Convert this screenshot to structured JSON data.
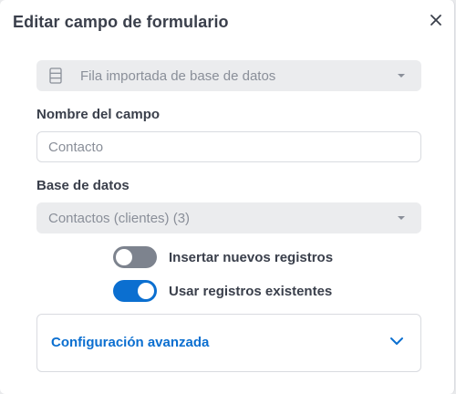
{
  "dialog": {
    "title": "Editar campo de formulario"
  },
  "source_select": {
    "value": "Fila importada de base de datos",
    "icon": "database-icon"
  },
  "field_name": {
    "label": "Nombre del campo",
    "placeholder": "Contacto"
  },
  "database": {
    "label": "Base de datos",
    "value": "Contactos (clientes) (3)"
  },
  "toggles": {
    "insert_new": {
      "label": "Insertar nuevos registros",
      "checked": false
    },
    "use_existing": {
      "label": "Usar registros existentes",
      "checked": true
    }
  },
  "advanced": {
    "label": "Configuración avanzada"
  },
  "colors": {
    "accent": "#0b6fd0",
    "toggle_off": "#7d838e",
    "text": "#3a3f4b"
  }
}
